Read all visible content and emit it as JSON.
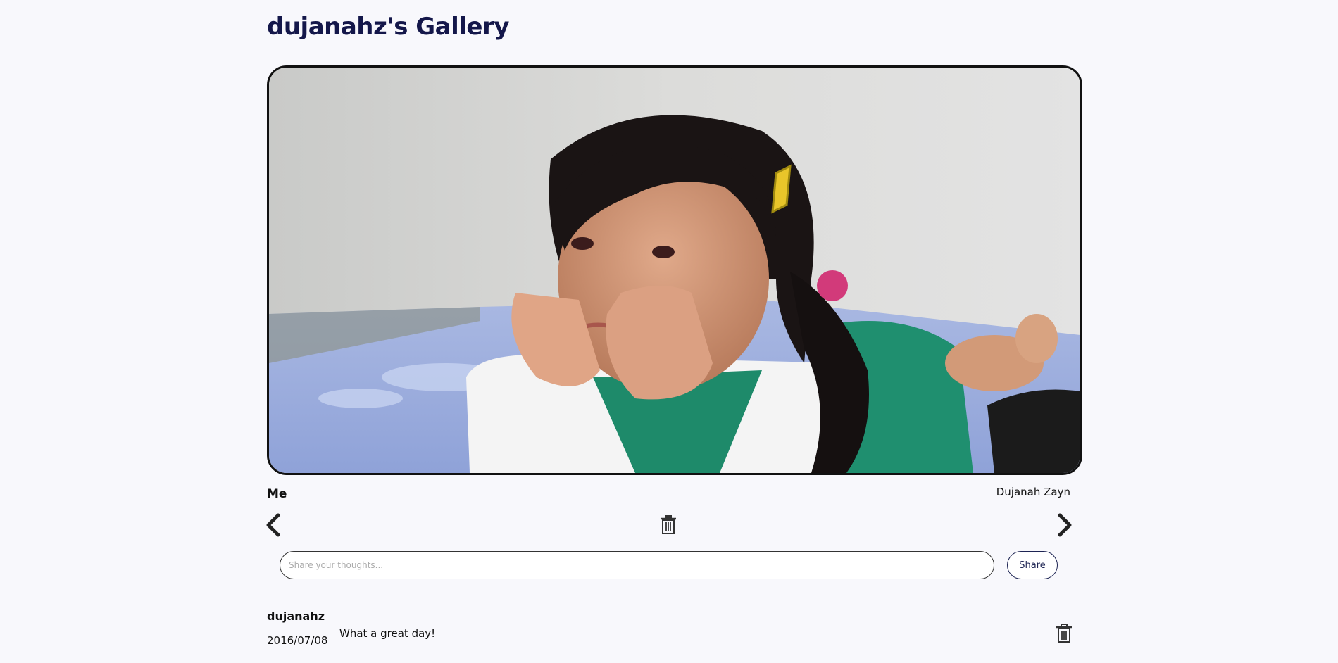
{
  "gallery": {
    "title": "dujanahz's Gallery"
  },
  "photo": {
    "caption": "Me",
    "author": "Dujanah Zayn"
  },
  "navigation": {
    "prev_icon": "chevron-left-icon",
    "next_icon": "chevron-right-icon",
    "delete_icon": "trash-icon"
  },
  "comment_form": {
    "placeholder": "Share your thoughts...",
    "value": "",
    "share_label": "Share"
  },
  "comments": [
    {
      "user": "dujanahz",
      "date": "2016/07/08",
      "text": "What a great day!"
    }
  ],
  "colors": {
    "background": "#f8f8fc",
    "title": "#14174a",
    "accent": "#1d2453"
  }
}
